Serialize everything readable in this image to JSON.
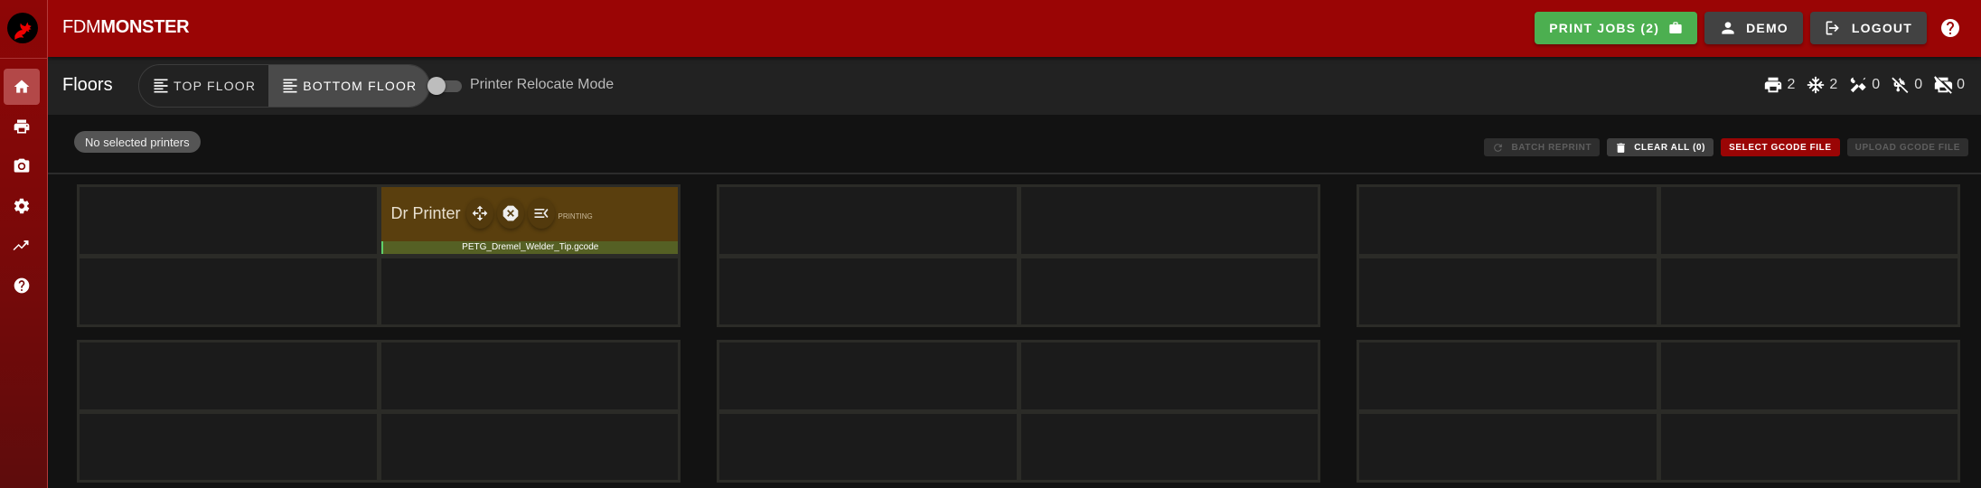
{
  "app": {
    "brand_light": "FDM",
    "brand_bold": "MONSTER",
    "accent_color": "#9a0505"
  },
  "sidebar": {
    "items": [
      {
        "name": "home",
        "icon": "home-icon",
        "active": true
      },
      {
        "name": "printers",
        "icon": "printer-icon",
        "active": false
      },
      {
        "name": "cameras",
        "icon": "camera-icon",
        "active": false
      },
      {
        "name": "settings",
        "icon": "gear-icon",
        "active": false
      },
      {
        "name": "statistics",
        "icon": "chart-line-icon",
        "active": false
      },
      {
        "name": "help",
        "icon": "help-circle-icon",
        "active": false
      }
    ]
  },
  "topbar": {
    "print_jobs_label": "PRINT JOBS (2)",
    "user_label": "DEMO",
    "logout_label": "LOGOUT"
  },
  "floorbar": {
    "title": "Floors",
    "floors": [
      {
        "label": "TOP FLOOR",
        "active": false
      },
      {
        "label": "BOTTOM FLOOR",
        "active": true
      }
    ],
    "relocate_label": "Printer Relocate Mode",
    "relocate_enabled": false,
    "stats": [
      {
        "icon": "printer-icon",
        "value": "2"
      },
      {
        "icon": "snowflake-icon",
        "value": "2"
      },
      {
        "icon": "tools-icon",
        "value": "0"
      },
      {
        "icon": "usb-off-icon",
        "value": "0"
      },
      {
        "icon": "printer-off-icon",
        "value": "0"
      }
    ]
  },
  "selection": {
    "chip_label": "No selected printers",
    "batch_reprint_label": "BATCH REPRINT",
    "clear_all_label": "CLEAR ALL (0)",
    "select_gcode_label": "SELECT GCODE FILE",
    "upload_gcode_label": "UPLOAD GCODE FILE"
  },
  "printer": {
    "name": "Dr Printer",
    "state": "PRINTING",
    "file": "PETG_Dremel_Welder_Tip.gcode"
  }
}
